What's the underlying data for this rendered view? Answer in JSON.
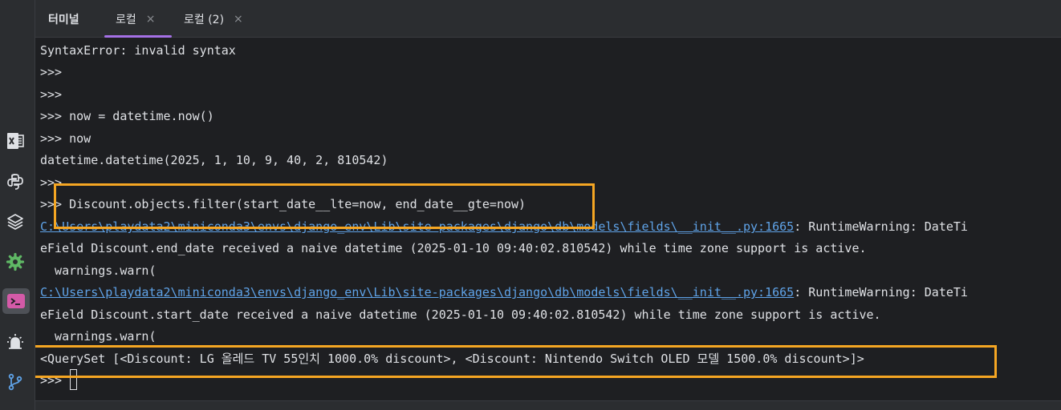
{
  "tabs": [
    {
      "title": "터미널",
      "closable": false,
      "active": false
    },
    {
      "title": "로컬",
      "closable": true,
      "active": true,
      "close": "×"
    },
    {
      "title": "로컬 (2)",
      "closable": true,
      "active": false,
      "close": "×"
    }
  ],
  "toolstrip": {
    "icons": [
      "excel-icon",
      "python-console-icon",
      "layers-icon",
      "settings-gear-icon",
      "terminal-icon",
      "notification-icon",
      "git-branch-icon"
    ],
    "active": "terminal-icon"
  },
  "terminal": {
    "lines": [
      {
        "text": "SyntaxError: invalid syntax"
      },
      {
        "text": ">>>"
      },
      {
        "text": ">>>"
      },
      {
        "text": ">>> now = datetime.now()"
      },
      {
        "text": ">>> now"
      },
      {
        "text": "datetime.datetime(2025, 1, 10, 9, 40, 2, 810542)"
      },
      {
        "text": ">>>"
      },
      {
        "text": ">>> Discount.objects.filter(start_date__lte=now, end_date__gte=now)"
      },
      {
        "link": "C:\\Users\\playdata2\\miniconda3\\envs\\django_env\\Lib\\site-packages\\django\\db\\models\\fields\\__init__.py:1665",
        "rest": ": RuntimeWarning: DateTi"
      },
      {
        "text": "eField Discount.end_date received a naive datetime (2025-01-10 09:40:02.810542) while time zone support is active."
      },
      {
        "text": "  warnings.warn("
      },
      {
        "link": "C:\\Users\\playdata2\\miniconda3\\envs\\django_env\\Lib\\site-packages\\django\\db\\models\\fields\\__init__.py:1665",
        "rest": ": RuntimeWarning: DateTi"
      },
      {
        "text": "eField Discount.start_date received a naive datetime (2025-01-10 09:40:02.810542) while time zone support is active."
      },
      {
        "text": "  warnings.warn("
      },
      {
        "text": "<QuerySet [<Discount: LG 올레드 TV 55인치 1000.0% discount>, <Discount: Nintendo Switch OLED 모델 1500.0% discount>]>"
      },
      {
        "text": ">>>",
        "cursor": true
      }
    ]
  },
  "colors": {
    "background": "#1e1f22",
    "text": "#dfe1e5",
    "link": "#5fa3e8",
    "highlight": "#f5a623",
    "active_tab_underline": "#a571e6"
  }
}
